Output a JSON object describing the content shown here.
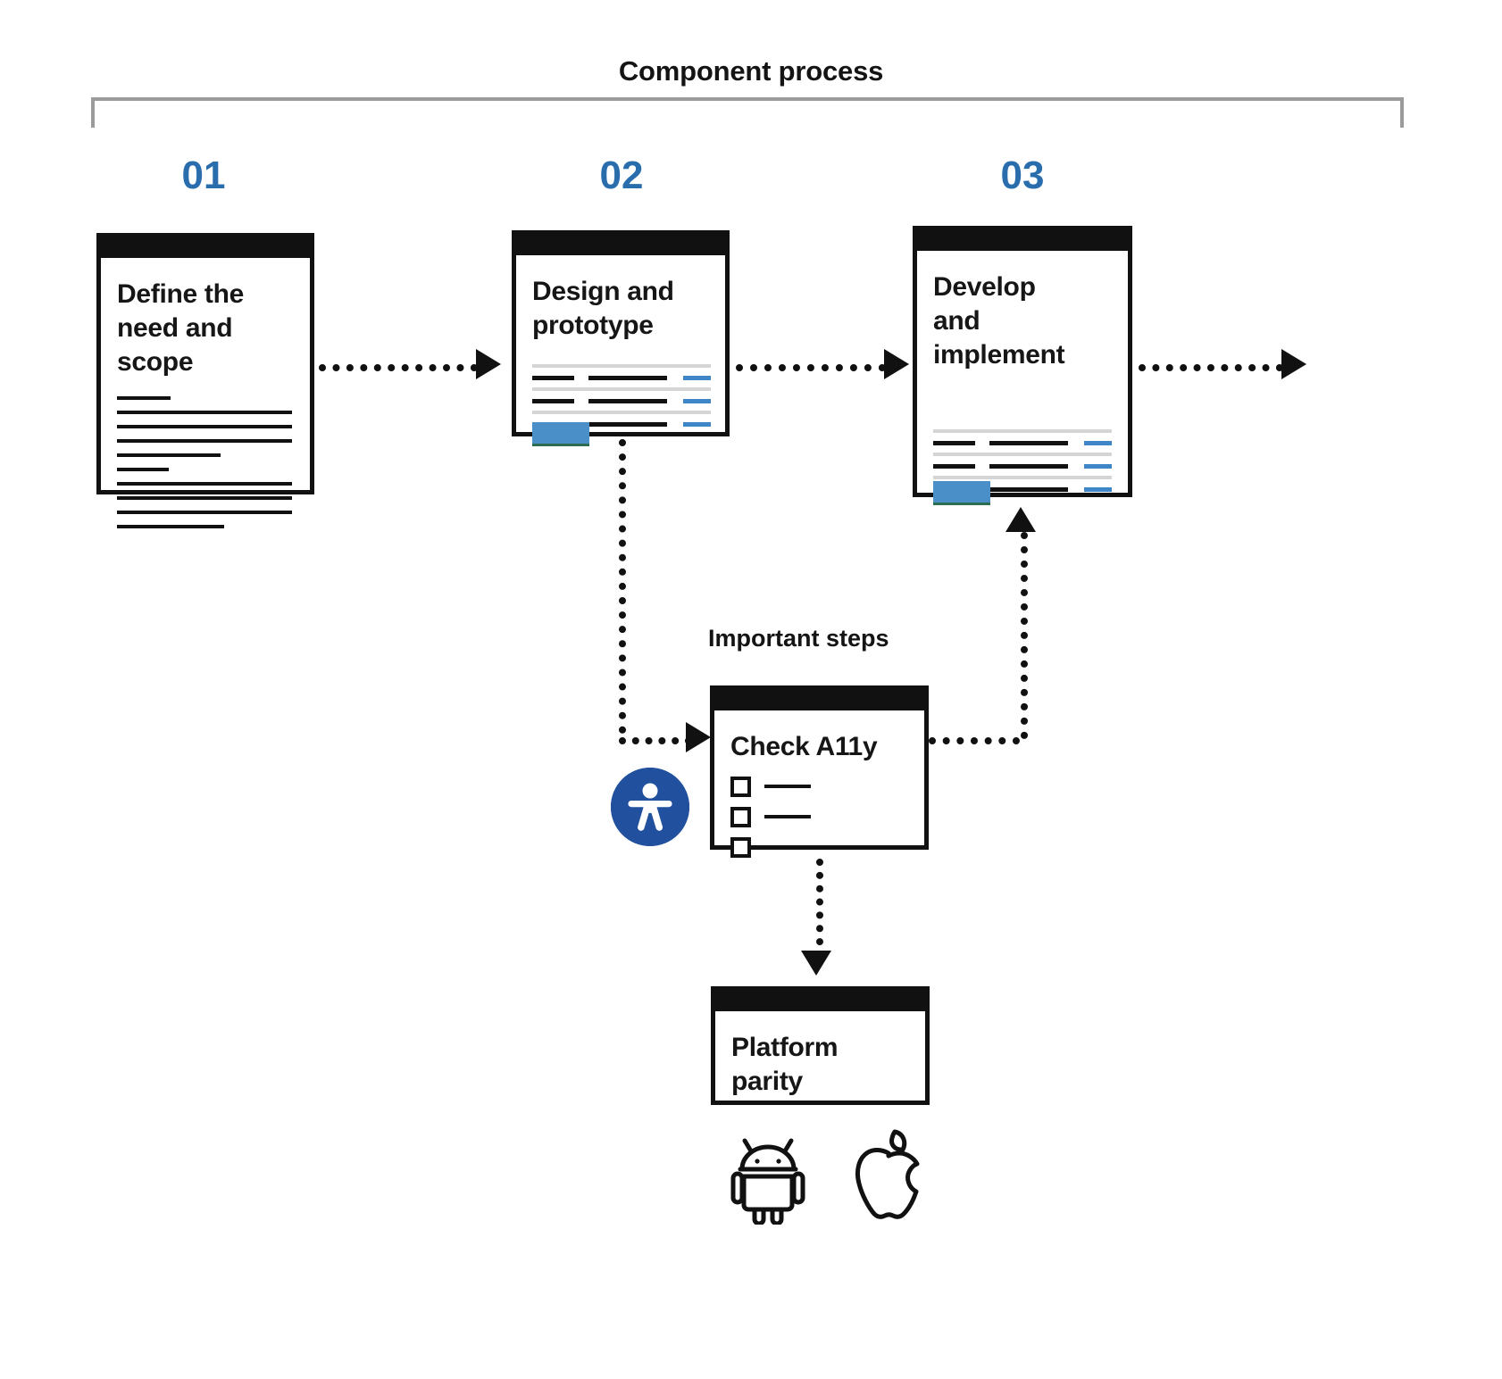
{
  "diagram": {
    "section_title": "Component process",
    "subsection_title": "Important steps",
    "accent_blue": "#2a6dad",
    "button_blue": "#4a8fc8",
    "table_link_blue": "#3f86c9",
    "badge_blue": "#21509e",
    "ink": "#111111",
    "bracket_gray": "#9b9b9b"
  },
  "steps": [
    {
      "number": "01",
      "title": "Define the\nneed and\nscope",
      "content_type": "document-lines"
    },
    {
      "number": "02",
      "title": "Design and\nprototype",
      "content_type": "table-with-button"
    },
    {
      "number": "03",
      "title": "Develop\nand\nimplement",
      "content_type": "table-with-button"
    }
  ],
  "important_steps": [
    {
      "title": "Check A11y",
      "content_type": "checklist",
      "checkbox_count": 3,
      "badge_icon": "accessibility-icon"
    },
    {
      "title": "Platform\nparity",
      "content_type": "empty",
      "platform_icons": [
        "android-icon",
        "apple-icon"
      ]
    }
  ],
  "chart_data": {
    "type": "diagram",
    "title": "Component process",
    "nodes": [
      {
        "id": "n1",
        "label": "Define the need and scope",
        "number": "01",
        "group": "Component process"
      },
      {
        "id": "n2",
        "label": "Design and prototype",
        "number": "02",
        "group": "Component process"
      },
      {
        "id": "n3",
        "label": "Develop and implement",
        "number": "03",
        "group": "Component process"
      },
      {
        "id": "n4",
        "label": "Check A11y",
        "group": "Important steps"
      },
      {
        "id": "n5",
        "label": "Platform parity",
        "group": "Important steps"
      }
    ],
    "edges": [
      {
        "from": "n1",
        "to": "n2",
        "style": "dotted-arrow"
      },
      {
        "from": "n2",
        "to": "n3",
        "style": "dotted-arrow"
      },
      {
        "from": "n3",
        "to": "end",
        "style": "dotted-arrow"
      },
      {
        "from": "n2",
        "to": "n4",
        "style": "dotted-arrow"
      },
      {
        "from": "n4",
        "to": "n3",
        "style": "dotted-arrow"
      },
      {
        "from": "n4",
        "to": "n5",
        "style": "dotted-arrow"
      }
    ]
  }
}
